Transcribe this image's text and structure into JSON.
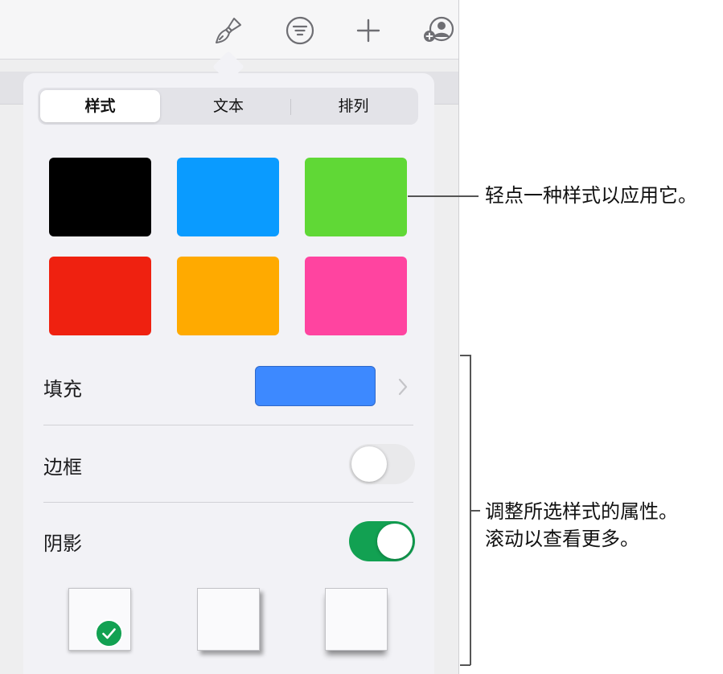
{
  "toolbar": {
    "icons": [
      "format-brush-icon",
      "filter-list-icon",
      "plus-icon",
      "add-person-icon"
    ]
  },
  "popover": {
    "tabs": [
      {
        "label": "样式",
        "active": true
      },
      {
        "label": "文本",
        "active": false
      },
      {
        "label": "排列",
        "active": false
      }
    ],
    "style_swatches": [
      "#000000",
      "#0a9bff",
      "#60d836",
      "#ef2110",
      "#ffaa00",
      "#ff44a0"
    ],
    "fill": {
      "label": "填充",
      "color": "#3d89ff"
    },
    "border": {
      "label": "边框",
      "enabled": false
    },
    "shadow": {
      "label": "阴影",
      "enabled": true,
      "toggle_on_color": "#12a152",
      "selected_option": 1,
      "options": [
        "contact-shadow",
        "drop-shadow",
        "curved-shadow"
      ]
    }
  },
  "colors": {
    "toggle_off": "#e9e9eb",
    "checkmark_badge": "#12a152"
  },
  "callouts": {
    "styles": "轻点一种样式以应用它。",
    "properties_line1": "调整所选样式的属性。",
    "properties_line2": "滚动以查看更多。"
  }
}
